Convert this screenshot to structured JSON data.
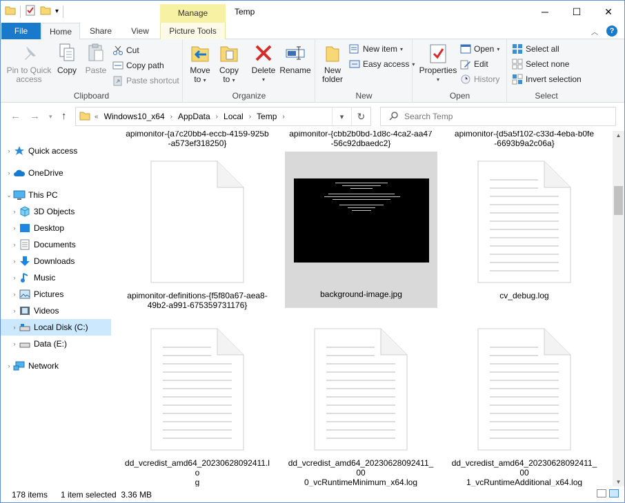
{
  "window": {
    "title": "Temp",
    "context_tab": "Manage",
    "minimize": "─",
    "maximize": "☐",
    "close": "✕"
  },
  "ribbon_tabs": [
    "File",
    "Home",
    "Share",
    "View",
    "Picture Tools"
  ],
  "ribbon": {
    "clipboard": {
      "label": "Clipboard",
      "pin": "Pin to Quick access",
      "pin_l1": "Pin to Quick",
      "pin_l2": "access",
      "copy": "Copy",
      "paste": "Paste",
      "cut": "Cut",
      "copy_path": "Copy path",
      "paste_shortcut": "Paste shortcut"
    },
    "organize": {
      "label": "Organize",
      "move_to_l1": "Move",
      "move_to_l2": "to",
      "copy_to_l1": "Copy",
      "copy_to_l2": "to",
      "delete": "Delete",
      "rename": "Rename"
    },
    "new": {
      "label": "New",
      "new_folder_l1": "New",
      "new_folder_l2": "folder",
      "new_item": "New item",
      "easy_access": "Easy access"
    },
    "open": {
      "label": "Open",
      "properties": "Properties",
      "open": "Open",
      "edit": "Edit",
      "history": "History"
    },
    "select": {
      "label": "Select",
      "select_all": "Select all",
      "select_none": "Select none",
      "invert_selection": "Invert selection"
    }
  },
  "address": {
    "overflow": "«",
    "crumbs": [
      "Windows10_x64",
      "AppData",
      "Local",
      "Temp"
    ],
    "search_placeholder": "Search Temp"
  },
  "nav_pane": {
    "quick_access": "Quick access",
    "onedrive": "OneDrive",
    "this_pc": "This PC",
    "objects_3d": "3D Objects",
    "desktop": "Desktop",
    "documents": "Documents",
    "downloads": "Downloads",
    "music": "Music",
    "pictures": "Pictures",
    "videos": "Videos",
    "local_disk": "Local Disk (C:)",
    "data_e": "Data (E:)",
    "network": "Network"
  },
  "files": {
    "top_row": [
      {
        "l1": "apimonitor-{a7c20bb4-eccb-4159-925b",
        "l2": "-a573ef318250}"
      },
      {
        "l1": "apimonitor-{cbb2b0bd-1d8c-4ca2-aa47",
        "l2": "-56c92dbaedc2}"
      },
      {
        "l1": "apimonitor-{d5a5f102-c33d-4eba-b0fe",
        "l2": "-6693b9a2c06a}"
      }
    ],
    "row2": [
      {
        "l1": "apimonitor-definitions-{f5f80a67-aea8-",
        "l2": "49b2-a991-675359731176}"
      },
      {
        "l1": "background-image.jpg",
        "l2": ""
      },
      {
        "l1": "cv_debug.log",
        "l2": ""
      }
    ],
    "row3": [
      {
        "l1": "dd_vcredist_amd64_20230628092411.lo",
        "l2": "g"
      },
      {
        "l1": "dd_vcredist_amd64_20230628092411_00",
        "l2": "0_vcRuntimeMinimum_x64.log"
      },
      {
        "l1": "dd_vcredist_amd64_20230628092411_00",
        "l2": "1_vcRuntimeAdditional_x64.log"
      }
    ]
  },
  "status": {
    "item_count": "178 items",
    "selection": "1 item selected  3.36 MB"
  },
  "colors": {
    "accent": "#1979ca",
    "context_tab": "#f7f1a3",
    "selection": "#cce8ff",
    "delete_red": "#d42b2b"
  }
}
